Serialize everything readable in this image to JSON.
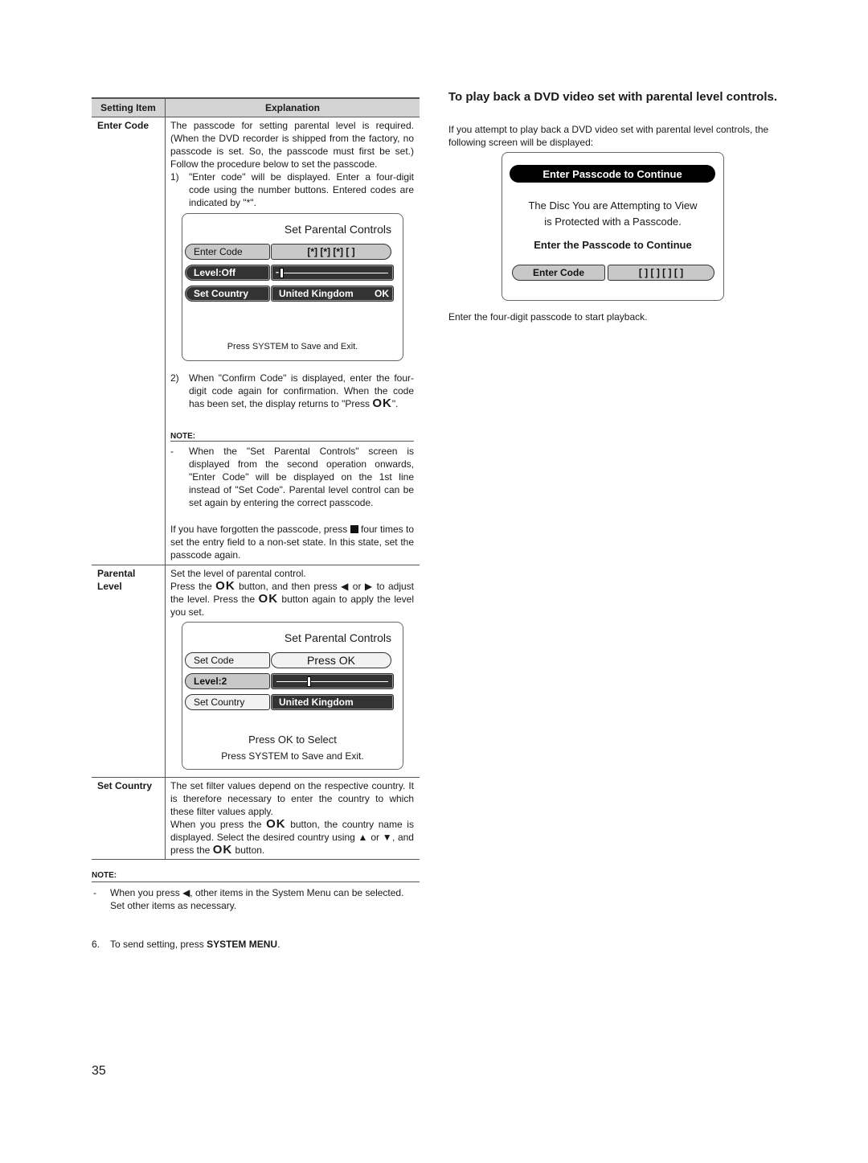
{
  "table": {
    "headers": [
      "Setting Item",
      "Explanation"
    ],
    "rows": [
      {
        "item": "Enter Code",
        "intro": "The passcode for setting parental level is required. (When the DVD recorder is shipped from the factory, no passcode is set. So, the passcode must first be set.) Follow the procedure below to set the passcode.",
        "step1_num": "1)",
        "step1": "\"Enter code\" will be displayed. Enter a four-digit code using the number buttons. Entered codes are indicated by \"*\".",
        "step2_num": "2)",
        "step2_a": "When \"Confirm Code\" is displayed, enter the four-digit code again for confirmation. When the code has been set, the display returns to \"Press ",
        "step2_ok": "OK",
        "step2_b": "\".",
        "note_label": "NOTE:",
        "note_dash": "-",
        "note_text": "When the \"Set Parental Controls\" screen is displayed from the second operation onwards, \"Enter Code\" will be displayed on the 1st line instead of \"Set Code\". Parental level control can be set again by entering the correct passcode.",
        "forgot_a": "If you have forgotten the passcode, press",
        "forgot_b": "four times to set the entry field to a non-set state. In this state, set the passcode again."
      },
      {
        "item_line1": "Parental",
        "item_line2": "Level",
        "line1": "Set the level of parental control.",
        "p_a": "Press the",
        "ok": "OK",
        "p_b": "button, and then press",
        "p_c": "or",
        "p_d": "to adjust the level. Press the",
        "p_e": "button again to apply the level you set."
      },
      {
        "item": "Set Country",
        "line1": "The set filter values depend on the respective country. It is therefore necessary to enter the country to which these filter values apply.",
        "p_a": "When you press the",
        "ok": "OK",
        "p_b": "button, the country name is displayed. Select the desired country using",
        "p_c": "or",
        "p_d": ", and press the",
        "p_e": "button."
      }
    ]
  },
  "screen1": {
    "title": "Set Parental Controls",
    "row1_label": "Enter Code",
    "row1_value": "[*] [*] [*] [ ]",
    "row2_label": "Level:Off",
    "row2_level_fraction": 0.0,
    "row2_prefix": "-",
    "row3_label": "Set Country",
    "row3_value": "United Kingdom",
    "row3_ok": "OK",
    "footer": "Press SYSTEM to Save and Exit."
  },
  "screen2": {
    "title": "Set Parental Controls",
    "row1_label": "Set Code",
    "row1_value": "Press OK",
    "row2_label": "Level:2",
    "row2_level_fraction": 0.28,
    "row3_label": "Set Country",
    "row3_value": "United Kingdom",
    "footer1": "Press OK to Select",
    "footer2": "Press SYSTEM to Save and Exit."
  },
  "bottom_note": {
    "label": "NOTE:",
    "dash": "-",
    "text_a": "When you press",
    "text_b": ", other items in the System Menu can be selected.",
    "text_c": "Set other items as necessary."
  },
  "step6": {
    "num": "6.",
    "text": "To send setting, press ",
    "bold": "SYSTEM MENU",
    "end": "."
  },
  "right": {
    "heading": "To play back a DVD video set with parental level controls.",
    "intro": "If you attempt to play back a DVD video set with parental level controls, the following screen will be displayed:",
    "screen": {
      "banner": "Enter Passcode to Continue",
      "msg1": "The Disc You are Attempting to View",
      "msg2": "is Protected with a Passcode.",
      "prompt": "Enter the Passcode to Continue",
      "code_label": "Enter Code",
      "code_value": "[ ] [ ] [ ] [ ]"
    },
    "caption": "Enter the four-digit passcode to start playback."
  },
  "page_number": "35"
}
